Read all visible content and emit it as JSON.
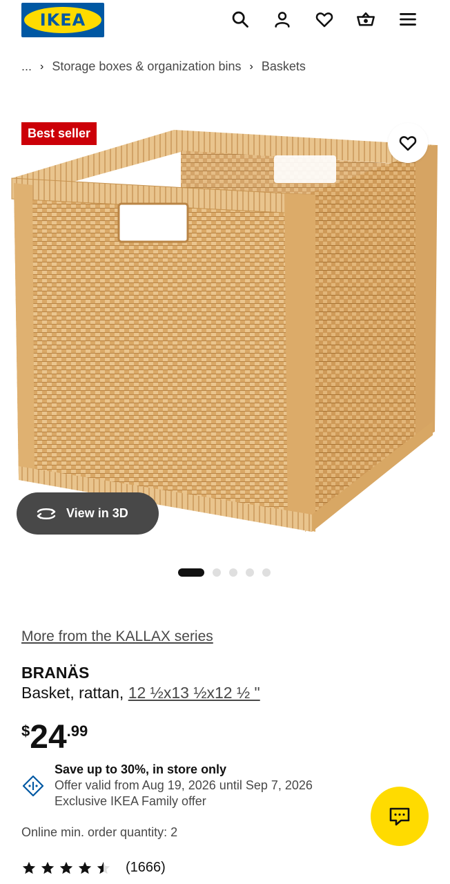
{
  "header": {
    "logo_text": "IKEA",
    "icons": [
      "search-icon",
      "user-icon",
      "heart-icon",
      "cart-icon",
      "menu-icon"
    ]
  },
  "breadcrumb": {
    "ellipsis": "...",
    "items": [
      "Storage boxes & organization bins",
      "Baskets"
    ]
  },
  "gallery": {
    "badge": "Best seller",
    "view3d_label": "View in 3D",
    "dot_count": 5,
    "active_dot": 0
  },
  "product": {
    "series_link": "More from the KALLAX series",
    "name": "BRANÄS",
    "description": "Basket, rattan,",
    "size": "12 ½x13 ½x12 ½ \"",
    "price": {
      "currency": "$",
      "integer": "24",
      "decimal": ".99"
    },
    "offer": {
      "title": "Save up to 30%, in store only",
      "validity": "Offer valid from Aug 19, 2026 until Sep 7, 2026",
      "note": "Exclusive IKEA Family offer"
    },
    "min_order": "Online min. order quantity: 2",
    "rating": 4.5,
    "review_count": "(1666)"
  },
  "colors": {
    "brand_blue": "#0058a3",
    "brand_yellow": "#ffdb00",
    "badge_red": "#cc0008",
    "text_dark": "#111111",
    "text_muted": "#484848",
    "offer_icon_blue": "#0058a3"
  }
}
